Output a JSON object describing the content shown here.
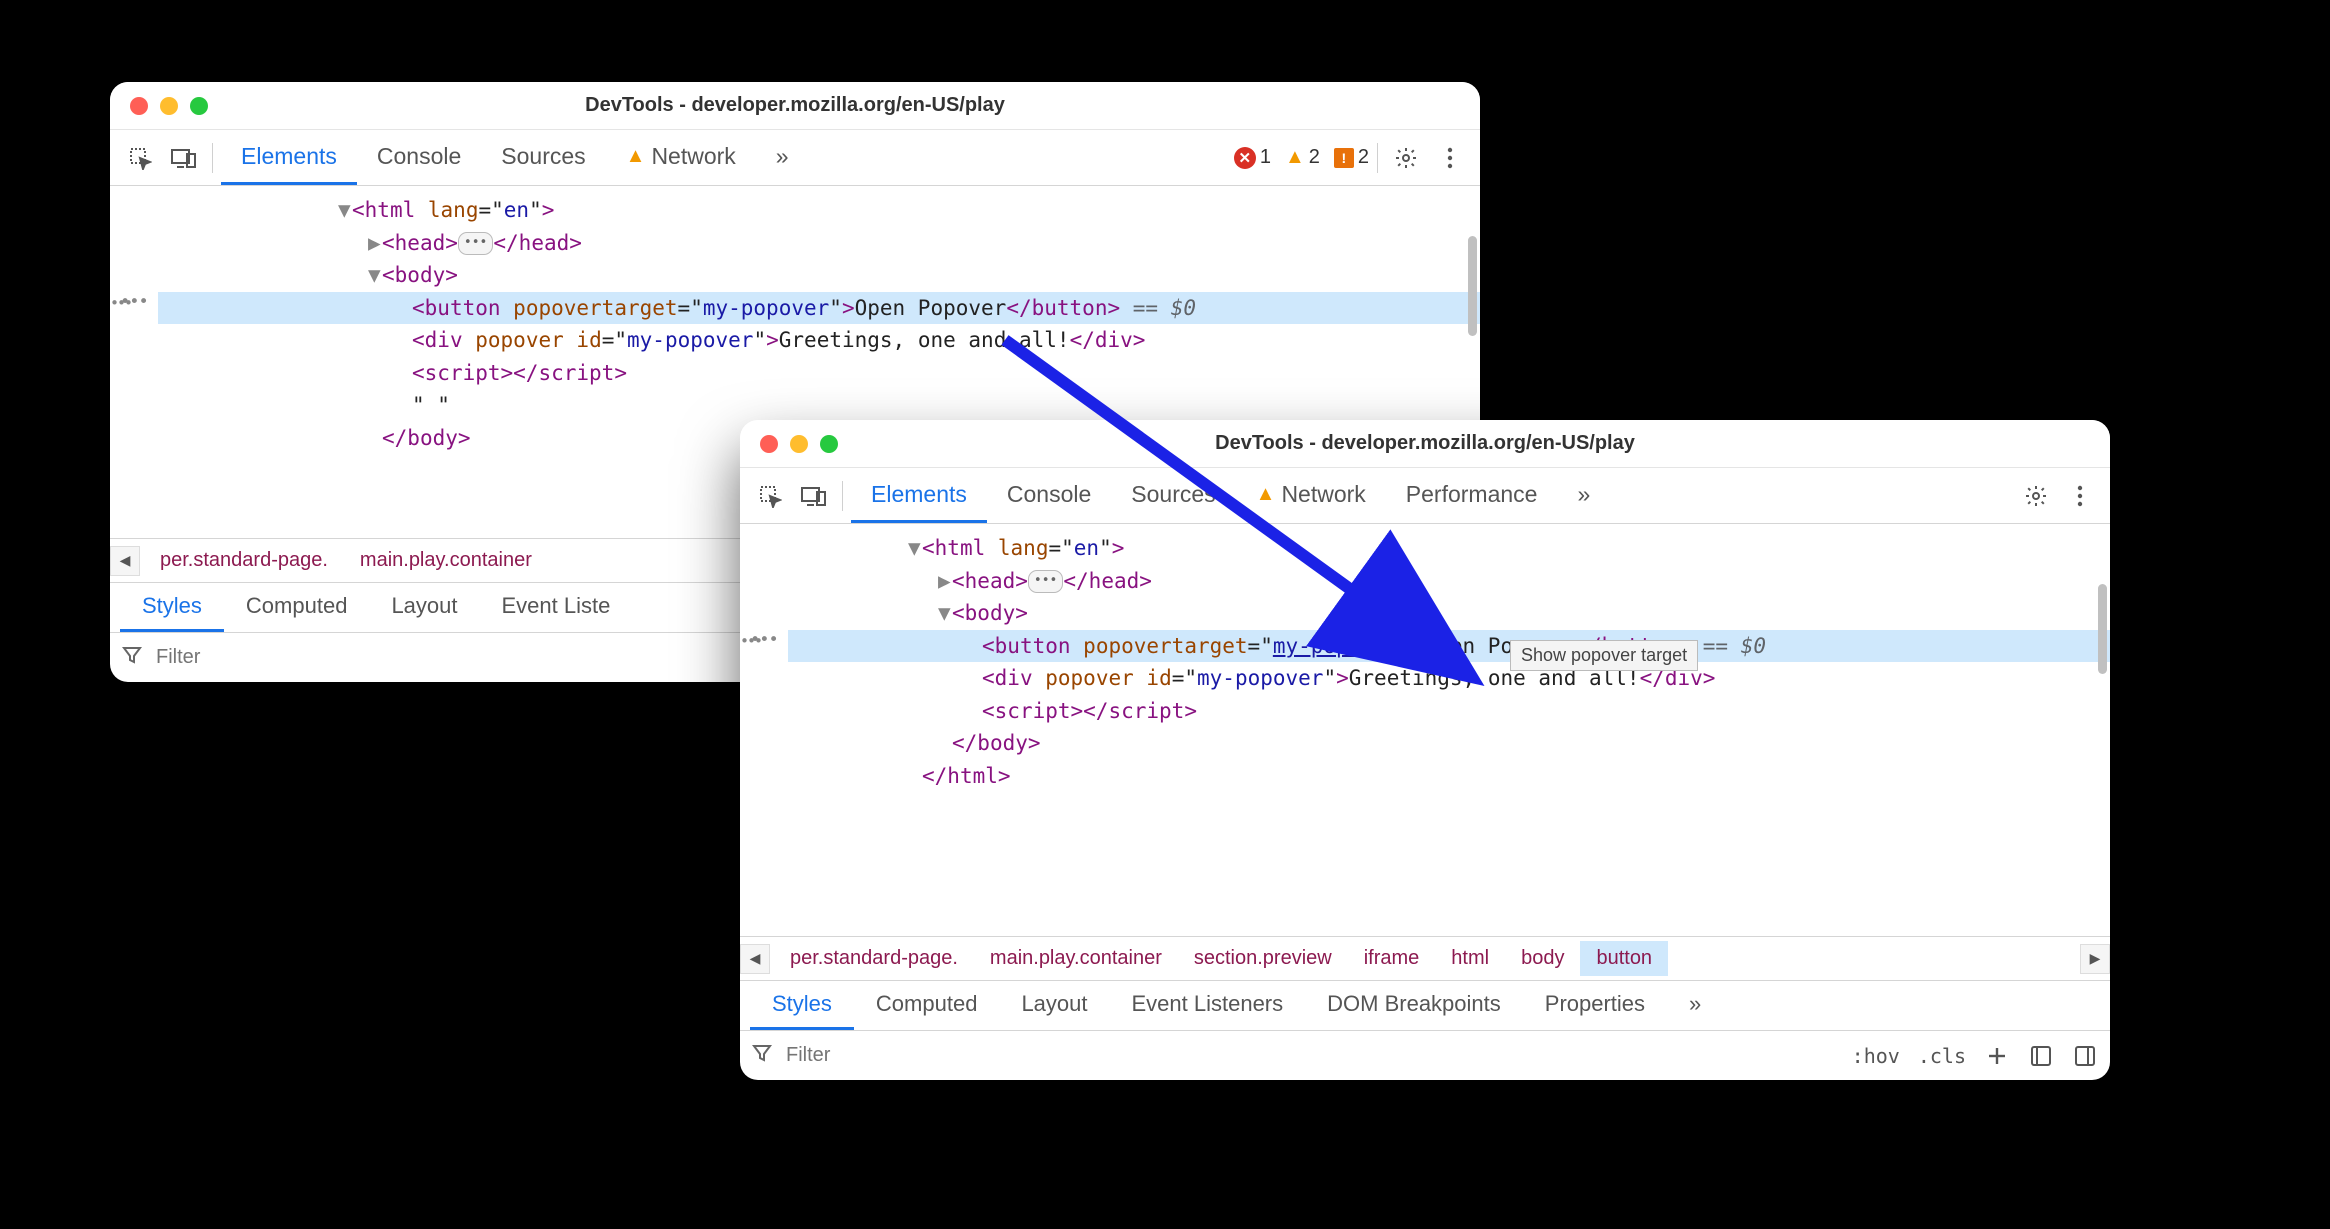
{
  "window1": {
    "title": "DevTools - developer.mozilla.org/en-US/play",
    "tabs": {
      "elements": "Elements",
      "console": "Console",
      "sources": "Sources",
      "network": "Network",
      "more": "»"
    },
    "issues": {
      "errors": "1",
      "warnings": "2",
      "info": "2"
    },
    "dom": {
      "html_open_tag": "html",
      "html_lang_attr": "lang",
      "html_lang_val": "en",
      "head_tag": "head",
      "body_tag": "body",
      "button_tag": "button",
      "button_attr": "popovertarget",
      "button_attr_val": "my-popover",
      "button_text": "Open Popover",
      "eq0": "== $0",
      "div_tag": "div",
      "div_attr1": "popover",
      "div_attr2": "id",
      "div_attr2_val": "my-popover",
      "div_text": "Greetings, one and all!",
      "script_tag": "script",
      "whitespace_line": "\" \""
    },
    "breadcrumb": {
      "item0": "per.standard-page.",
      "item1": "main.play.container"
    },
    "subtabs": {
      "styles": "Styles",
      "computed": "Computed",
      "layout": "Layout",
      "events": "Event Liste"
    },
    "filter_placeholder": "Filter"
  },
  "window2": {
    "title": "DevTools - developer.mozilla.org/en-US/play",
    "tabs": {
      "elements": "Elements",
      "console": "Console",
      "sources": "Sources",
      "network": "Network",
      "performance": "Performance",
      "more": "»"
    },
    "tooltip": "Show popover target",
    "dom": {
      "html_open_tag": "html",
      "html_lang_attr": "lang",
      "html_lang_val": "en",
      "head_tag": "head",
      "body_tag": "body",
      "button_tag": "button",
      "button_attr": "popovertarget",
      "button_attr_val": "my-popover",
      "button_text": "Open Popover",
      "eq0": "== $0",
      "div_tag": "div",
      "div_attr1": "popover",
      "div_attr2": "id",
      "div_attr2_val": "my-popover",
      "div_text": "Greetings, one and all!",
      "script_tag": "script",
      "body_close": "body",
      "html_close": "html"
    },
    "breadcrumb": {
      "item0": "per.standard-page.",
      "item1": "main.play.container",
      "item2": "section.preview",
      "item3": "iframe",
      "item4": "html",
      "item5": "body",
      "item6": "button"
    },
    "subtabs": {
      "styles": "Styles",
      "computed": "Computed",
      "layout": "Layout",
      "events": "Event Listeners",
      "dom_bp": "DOM Breakpoints",
      "props": "Properties",
      "more": "»"
    },
    "filter_placeholder": "Filter",
    "hov": ":hov",
    "cls": ".cls"
  }
}
